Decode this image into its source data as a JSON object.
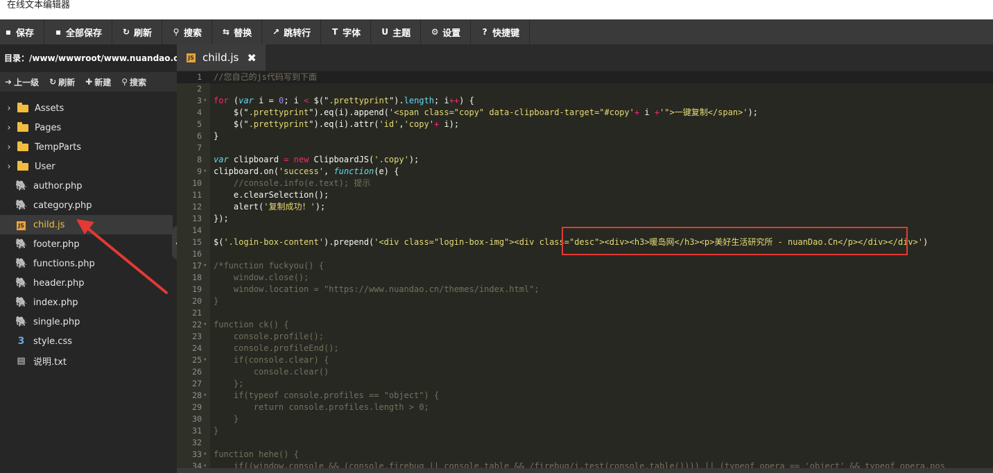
{
  "window": {
    "title": "在线文本编辑器"
  },
  "toolbar": {
    "buttons": [
      {
        "label": "保存",
        "icon": "save-icon",
        "glyph": "▪"
      },
      {
        "label": "全部保存",
        "icon": "save-all-icon",
        "glyph": "▪"
      },
      {
        "label": "刷新",
        "icon": "refresh-icon",
        "glyph": "↻"
      },
      {
        "label": "搜索",
        "icon": "search-icon",
        "glyph": "⚲"
      },
      {
        "label": "替换",
        "icon": "replace-icon",
        "glyph": "⇆"
      },
      {
        "label": "跳转行",
        "icon": "goto-line-icon",
        "glyph": "↗"
      },
      {
        "label": "字体",
        "icon": "font-icon",
        "glyph": "T"
      },
      {
        "label": "主题",
        "icon": "theme-icon",
        "glyph": "U"
      },
      {
        "label": "设置",
        "icon": "gear-icon",
        "glyph": "⚙"
      },
      {
        "label": "快捷键",
        "icon": "help-icon",
        "glyph": "?"
      }
    ]
  },
  "sidebar": {
    "path": "目录：/www/wwwroot/www.nuandao.c...",
    "actions": [
      {
        "label": "上一级",
        "icon": "up-level-icon",
        "glyph": "➜"
      },
      {
        "label": "刷新",
        "icon": "refresh-icon",
        "glyph": "↻"
      },
      {
        "label": "新建",
        "icon": "plus-icon",
        "glyph": "✚"
      },
      {
        "label": "搜索",
        "icon": "search-icon",
        "glyph": "⚲"
      }
    ],
    "items": [
      {
        "name": "Assets",
        "type": "folder"
      },
      {
        "name": "Pages",
        "type": "folder"
      },
      {
        "name": "TempParts",
        "type": "folder"
      },
      {
        "name": "User",
        "type": "folder"
      },
      {
        "name": "author.php",
        "type": "php"
      },
      {
        "name": "category.php",
        "type": "php"
      },
      {
        "name": "child.js",
        "type": "js",
        "active": true
      },
      {
        "name": "footer.php",
        "type": "php"
      },
      {
        "name": "functions.php",
        "type": "php"
      },
      {
        "name": "header.php",
        "type": "php"
      },
      {
        "name": "index.php",
        "type": "php"
      },
      {
        "name": "single.php",
        "type": "php"
      },
      {
        "name": "style.css",
        "type": "css"
      },
      {
        "name": "说明.txt",
        "type": "txt"
      }
    ]
  },
  "tabs": [
    {
      "label": "child.js",
      "icon": "js-file-icon",
      "close": "✖"
    }
  ],
  "colors": {
    "toolbar_bg": "#3a3a3a",
    "sidebar_bg": "#262626",
    "editor_bg": "#272822",
    "active_file": "#f0c040",
    "highlight_box": "#e53935"
  },
  "editor": {
    "lines": [
      {
        "n": "1",
        "fold": false,
        "t": [
          [
            "//您自己的js代码写到下面",
            "dim"
          ]
        ]
      },
      {
        "n": "2",
        "fold": false,
        "t": []
      },
      {
        "n": "3",
        "fold": true,
        "t": [
          [
            "for",
            "kw"
          ],
          [
            " (",
            "default"
          ],
          [
            "var",
            "var"
          ],
          [
            " i = ",
            "default"
          ],
          [
            "0",
            "num"
          ],
          [
            "; i ",
            "default"
          ],
          [
            "<",
            "kw"
          ],
          [
            " $(\"",
            "default"
          ],
          [
            ".prettyprint",
            "str"
          ],
          [
            "\").",
            "default"
          ],
          [
            "length",
            "fn"
          ],
          [
            "; i",
            "default"
          ],
          [
            "++",
            "kw"
          ],
          [
            ") {",
            "default"
          ]
        ]
      },
      {
        "n": "4",
        "fold": false,
        "t": [
          [
            "    $(\"",
            "default"
          ],
          [
            ".prettyprint",
            "str"
          ],
          [
            "\").eq(i).append(",
            "default"
          ],
          [
            "'<span class=\"copy\" data-clipboard-target=\"#copy'",
            "str"
          ],
          [
            "+",
            "kw"
          ],
          [
            " i ",
            "default"
          ],
          [
            "+",
            "kw"
          ],
          [
            "'\">一键复制</span>'",
            "str"
          ],
          [
            ");",
            "default"
          ]
        ]
      },
      {
        "n": "5",
        "fold": false,
        "t": [
          [
            "    $(\"",
            "default"
          ],
          [
            ".prettyprint",
            "str"
          ],
          [
            "\").eq(i).attr(",
            "default"
          ],
          [
            "'id'",
            "str"
          ],
          [
            ",",
            "default"
          ],
          [
            "'copy'",
            "str"
          ],
          [
            "+",
            "kw"
          ],
          [
            " i);",
            "default"
          ]
        ]
      },
      {
        "n": "6",
        "fold": false,
        "t": [
          [
            "}",
            "default"
          ]
        ]
      },
      {
        "n": "7",
        "fold": false,
        "t": []
      },
      {
        "n": "8",
        "fold": false,
        "t": [
          [
            "var",
            "var"
          ],
          [
            " clipboard ",
            "default"
          ],
          [
            "=",
            "kw"
          ],
          [
            " ",
            "default"
          ],
          [
            "new",
            "kw"
          ],
          [
            " ClipboardJS(",
            "default"
          ],
          [
            "'.copy'",
            "str"
          ],
          [
            ");",
            "default"
          ]
        ]
      },
      {
        "n": "9",
        "fold": true,
        "t": [
          [
            "clipboard.on(",
            "default"
          ],
          [
            "'success'",
            "str"
          ],
          [
            ", ",
            "default"
          ],
          [
            "function",
            "var"
          ],
          [
            "(e) {",
            "default"
          ]
        ]
      },
      {
        "n": "10",
        "fold": false,
        "t": [
          [
            "    //console.info(e.text); 提示",
            "dim"
          ]
        ]
      },
      {
        "n": "11",
        "fold": false,
        "t": [
          [
            "    e.clearSelection();",
            "default"
          ]
        ]
      },
      {
        "n": "12",
        "fold": false,
        "t": [
          [
            "    alert(",
            "default"
          ],
          [
            "'复制成功！'",
            "str"
          ],
          [
            ");",
            "default"
          ]
        ]
      },
      {
        "n": "13",
        "fold": false,
        "t": [
          [
            "});",
            "default"
          ]
        ]
      },
      {
        "n": "14",
        "fold": false,
        "t": []
      },
      {
        "n": "15",
        "fold": false,
        "t": [
          [
            "$(",
            "default"
          ],
          [
            "'.login-box-content'",
            "str"
          ],
          [
            ").prepend(",
            "default"
          ],
          [
            "'<div class=\"login-box-img\"><div class=\"desc\"><div><h3>暖岛网</h3><p>美好生活研究所 - nuanDao.Cn</p></div></div>'",
            "str"
          ],
          [
            ")",
            "default"
          ]
        ]
      },
      {
        "n": "16",
        "fold": false,
        "t": []
      },
      {
        "n": "17",
        "fold": true,
        "t": [
          [
            "/*function fuckyou() {",
            "dim"
          ]
        ]
      },
      {
        "n": "18",
        "fold": false,
        "t": [
          [
            "    window.close();",
            "dim"
          ]
        ]
      },
      {
        "n": "19",
        "fold": false,
        "t": [
          [
            "    window.location = \"https://www.nuandao.cn/themes/index.html\";",
            "dim"
          ]
        ]
      },
      {
        "n": "20",
        "fold": false,
        "t": [
          [
            "}",
            "dim"
          ]
        ]
      },
      {
        "n": "21",
        "fold": false,
        "t": []
      },
      {
        "n": "22",
        "fold": true,
        "t": [
          [
            "function ck() {",
            "dim"
          ]
        ]
      },
      {
        "n": "23",
        "fold": false,
        "t": [
          [
            "    console.profile();",
            "dim"
          ]
        ]
      },
      {
        "n": "24",
        "fold": false,
        "t": [
          [
            "    console.profileEnd();",
            "dim"
          ]
        ]
      },
      {
        "n": "25",
        "fold": true,
        "t": [
          [
            "    if(console.clear) {",
            "dim"
          ]
        ]
      },
      {
        "n": "26",
        "fold": false,
        "t": [
          [
            "        console.clear()",
            "dim"
          ]
        ]
      },
      {
        "n": "27",
        "fold": false,
        "t": [
          [
            "    };",
            "dim"
          ]
        ]
      },
      {
        "n": "28",
        "fold": true,
        "t": [
          [
            "    if(typeof console.profiles == \"object\") {",
            "dim"
          ]
        ]
      },
      {
        "n": "29",
        "fold": false,
        "t": [
          [
            "        return console.profiles.length > 0;",
            "dim"
          ]
        ]
      },
      {
        "n": "30",
        "fold": false,
        "t": [
          [
            "    }",
            "dim"
          ]
        ]
      },
      {
        "n": "31",
        "fold": false,
        "t": [
          [
            "}",
            "dim"
          ]
        ]
      },
      {
        "n": "32",
        "fold": false,
        "t": []
      },
      {
        "n": "33",
        "fold": true,
        "t": [
          [
            "function hehe() {",
            "dim"
          ]
        ]
      },
      {
        "n": "34",
        "fold": true,
        "t": [
          [
            "    if((window.console && (console.firebug || console.table && /firebug/i.test(console.table()))) || (typeof opera == 'object' && typeof opera.pos",
            "dim"
          ]
        ]
      }
    ]
  }
}
